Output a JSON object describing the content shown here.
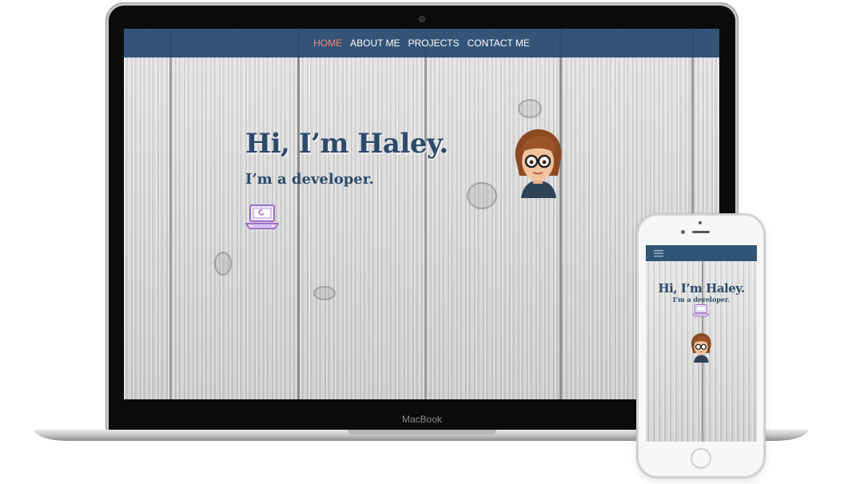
{
  "navigation": {
    "items": [
      "HOME",
      "ABOUT ME",
      "PROJECTS",
      "CONTACT ME"
    ],
    "active": "HOME"
  },
  "hero": {
    "title": "Hi, I’m Haley.",
    "subtitle": "I’m a developer."
  },
  "device": {
    "laptop_brand": "MacBook"
  },
  "mobile": {
    "title": "Hi, I’m Haley.",
    "subtitle": "I’m a developer."
  },
  "icons": {
    "menu": "hamburger-menu-icon",
    "laptop": "laptop-icon",
    "avatar": "avatar-bitmoji"
  },
  "colors": {
    "navbar": "#2c4f73",
    "active_link": "#f08a7a",
    "heading": "#2c4a6b",
    "laptop_icon": "#9b6fc9"
  }
}
